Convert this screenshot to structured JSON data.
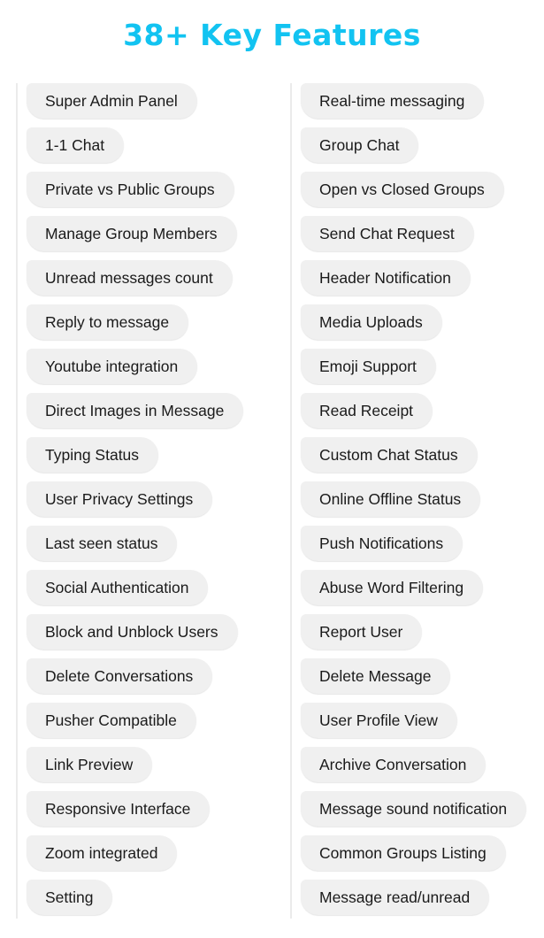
{
  "title": "38+ Key Features",
  "colors": {
    "title": "#12c3f1",
    "pill_bg": "#f0f0f0",
    "divider": "#ebebeb"
  },
  "features_left": [
    "Super Admin Panel",
    "1-1 Chat",
    "Private vs Public Groups",
    "Manage Group Members",
    "Unread messages count",
    "Reply to message",
    "Youtube integration",
    "Direct Images in Message",
    "Typing Status",
    "User Privacy Settings",
    "Last seen status",
    "Social Authentication",
    "Block and Unblock Users",
    "Delete Conversations",
    "Pusher Compatible",
    "Link Preview",
    "Responsive Interface",
    "Zoom integrated",
    "Setting"
  ],
  "features_right": [
    "Real-time messaging",
    "Group Chat",
    "Open vs Closed Groups",
    "Send Chat Request",
    "Header Notification",
    "Media Uploads",
    "Emoji Support",
    "Read Receipt",
    "Custom Chat Status",
    "Online Offline Status",
    "Push Notifications",
    "Abuse Word Filtering",
    "Report User",
    "Delete Message",
    "User Profile View",
    "Archive Conversation",
    "Message sound notification",
    "Common Groups Listing",
    "Message read/unread"
  ]
}
